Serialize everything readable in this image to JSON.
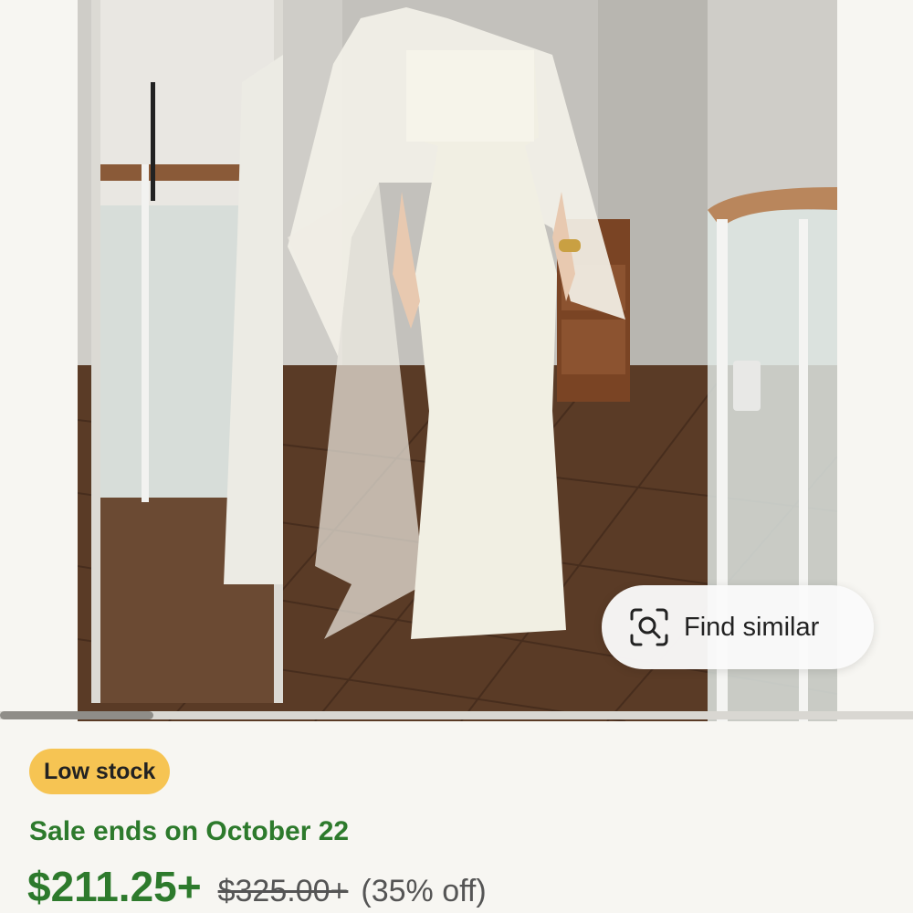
{
  "hero": {
    "image_description_icon": "product-photo",
    "find_similar": {
      "label": "Find similar",
      "icon": "visual-search-icon"
    }
  },
  "listing": {
    "badge": "Low stock",
    "sale_text": "Sale ends on October 22",
    "price": "$211.25+",
    "original_price": "$325.00+",
    "discount": "(35% off)"
  },
  "colors": {
    "accent_green": "#2d7a2c",
    "badge_yellow": "#f6c453"
  }
}
